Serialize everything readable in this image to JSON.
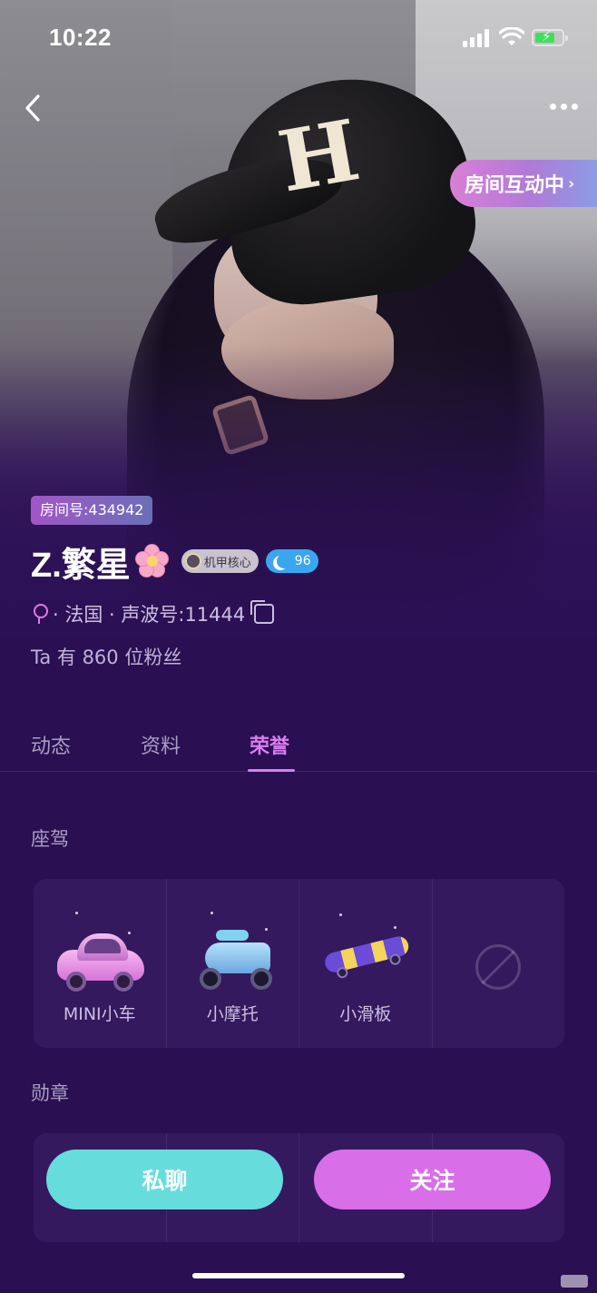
{
  "status_bar": {
    "time": "10:22"
  },
  "header": {
    "room_pill_label": "房间互动中",
    "room_pill_chevron": "›"
  },
  "profile": {
    "room_id_label": "房间号:434942",
    "name": "Z.繁星",
    "badge_mech_label": "机甲核心",
    "level_value": "96",
    "meta_line": "· 法国 · 声波号:11444",
    "fans_text": "Ta 有 860 位粉丝"
  },
  "tabs": [
    {
      "label": "动态",
      "active": false
    },
    {
      "label": "资料",
      "active": false
    },
    {
      "label": "荣誉",
      "active": true
    }
  ],
  "sections": {
    "vehicles_title": "座驾",
    "vehicles": [
      {
        "label": "MINI小车",
        "icon": "pink-car-icon"
      },
      {
        "label": "小摩托",
        "icon": "blue-scooter-icon"
      },
      {
        "label": "小滑板",
        "icon": "skateboard-icon"
      },
      {
        "label": "",
        "icon": "empty-slot-icon"
      }
    ],
    "medals_title": "勋章"
  },
  "actions": {
    "chat_label": "私聊",
    "follow_label": "关注"
  },
  "colors": {
    "background": "#2a0f52",
    "active_tab": "#d97df0",
    "chat_button": "#66dcdc",
    "follow_button": "#d86ee8"
  }
}
